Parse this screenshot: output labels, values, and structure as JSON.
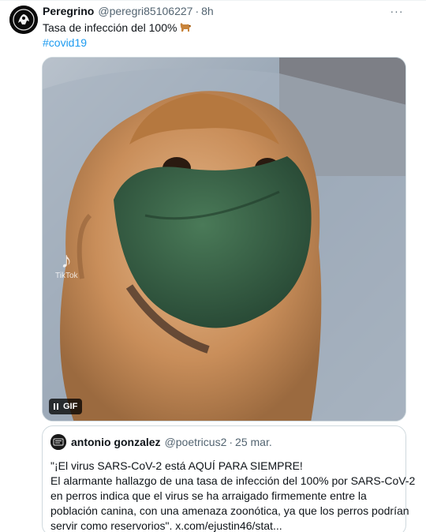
{
  "tweet": {
    "author_name": "Peregrino",
    "author_handle": "@peregri85106227",
    "separator": "·",
    "time": "8h",
    "text": "Tasa de infección del 100%",
    "hashtag": "#covid19",
    "more_label": "···"
  },
  "media": {
    "type_label": "GIF",
    "watermark": "TikTok"
  },
  "quoted_tweet": {
    "author_name": "antonio gonzalez",
    "author_handle": "@poetricus2",
    "separator": "·",
    "date": "25 mar.",
    "lines": [
      "\"¡El virus SARS-CoV-2 está AQUÍ PARA SIEMPRE!",
      "El alarmante hallazgo de una tasa de infección del 100% por SARS-CoV-2",
      "en perros indica que el virus se ha arraigado firmemente entre la",
      "población canina, con una amenaza zoonótica, ya que los perros podrían",
      "servir como reservorios\". x.com/ejustin46/stat..."
    ]
  },
  "colors": {
    "link": "#1d9bf0",
    "secondary_text": "#536471",
    "border": "#cfd9de"
  }
}
